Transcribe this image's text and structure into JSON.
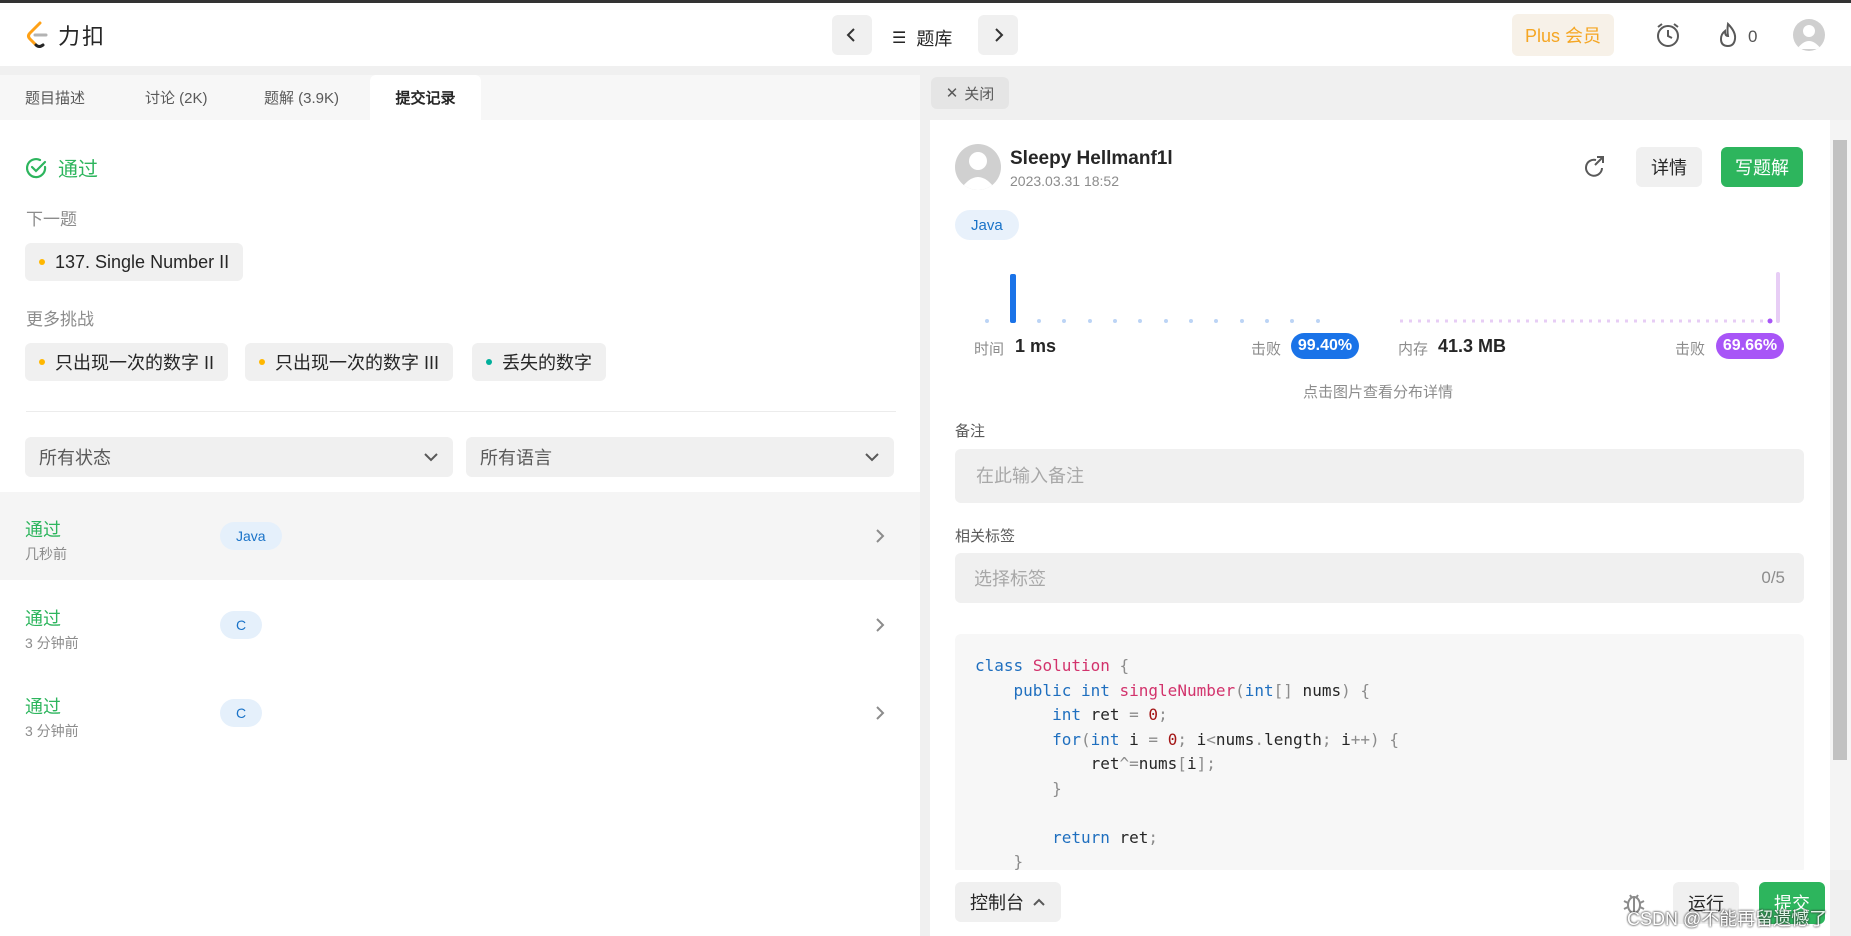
{
  "app": {
    "logo_text": "力扣"
  },
  "topnav": {
    "problemset_label": "题库",
    "plus_label": "Plus 会员",
    "fire_count": "0"
  },
  "left": {
    "tabs": [
      {
        "label": "题目描述",
        "active": false
      },
      {
        "label": "讨论 (2K)",
        "active": false
      },
      {
        "label": "题解 (3.9K)",
        "active": false
      },
      {
        "label": "提交记录",
        "active": true
      }
    ],
    "result_status": "通过",
    "next_label": "下一题",
    "next_problem": {
      "title": "137. Single Number II",
      "dot_color": "#ffb700"
    },
    "more_label": "更多挑战",
    "more_problems": [
      {
        "title": "只出现一次的数字 II",
        "dot_color": "#ffb700"
      },
      {
        "title": "只出现一次的数字 III",
        "dot_color": "#ffb700"
      },
      {
        "title": "丢失的数字",
        "dot_color": "#00af9b"
      }
    ],
    "filters": {
      "status": "所有状态",
      "language": "所有语言"
    },
    "submissions": [
      {
        "status": "通过",
        "time": "几秒前",
        "lang": "Java"
      },
      {
        "status": "通过",
        "time": "3 分钟前",
        "lang": "C"
      },
      {
        "status": "通过",
        "time": "3 分钟前",
        "lang": "C"
      }
    ]
  },
  "right": {
    "close_tab": "关闭",
    "user": {
      "name": "Sleepy Hellmanf1l",
      "date": "2023.03.31 18:52"
    },
    "detail_button": "详情",
    "write_button": "写题解",
    "lang_pill": "Java",
    "runtime": {
      "label": "时间",
      "value": "1 ms",
      "beat_label": "击败",
      "beat": "99.40%",
      "color": "#1a73e8"
    },
    "memory": {
      "label": "内存",
      "value": "41.3 MB",
      "beat_label": "击败",
      "beat": "69.66%",
      "color": "#a855f7"
    },
    "dist_hint": "点击图片查看分布详情",
    "note_label": "备注",
    "note_placeholder": "在此输入备注",
    "tags_label": "相关标签",
    "tags_placeholder": "选择标签",
    "tags_count": "0/5",
    "console_label": "控制台",
    "run_button": "运行",
    "submit_button": "提交",
    "watermark": "CSDN @不能再留遗憾了"
  },
  "colors": {
    "accent_green": "#2db55d",
    "accent_blue": "#1a73e8",
    "accent_purple": "#a855f7",
    "brand_orange": "#ffa116"
  },
  "icons": [
    "logo-icon",
    "chevron-left-icon",
    "chevron-right-icon",
    "list-icon",
    "alarm-icon",
    "fire-icon",
    "avatar-icon",
    "check-circle-icon",
    "chevron-down-icon",
    "close-icon",
    "share-icon",
    "bug-icon",
    "chevron-up-icon"
  ]
}
